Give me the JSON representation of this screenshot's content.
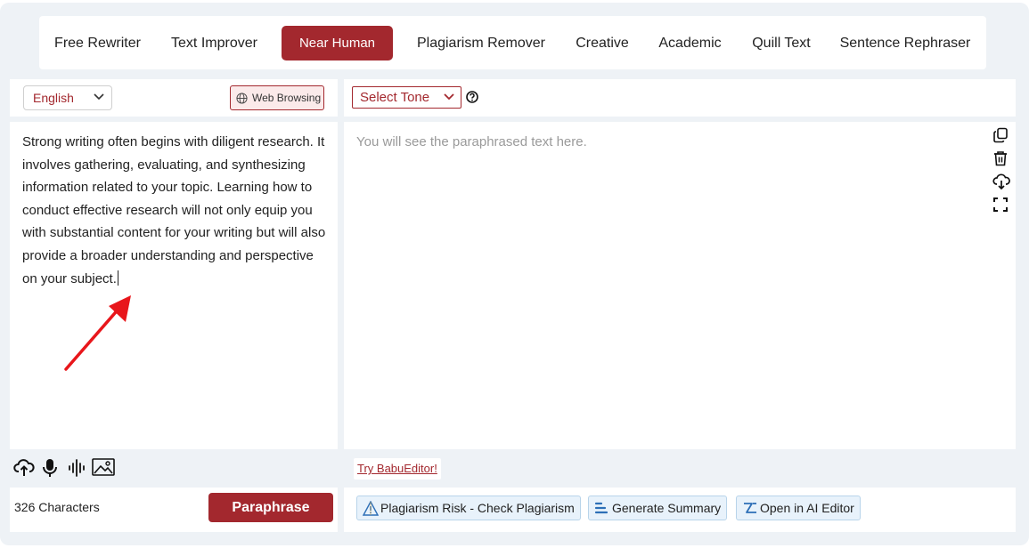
{
  "modes": [
    {
      "label": "Free Rewriter"
    },
    {
      "label": "Text Improver"
    },
    {
      "label": "Near Human",
      "active": true
    },
    {
      "label": "Plagiarism Remover"
    },
    {
      "label": "Creative"
    },
    {
      "label": "Academic"
    },
    {
      "label": "Quill Text"
    },
    {
      "label": "Sentence Rephraser"
    }
  ],
  "input_panel": {
    "language": "English",
    "web_browsing_label": "Web Browsing",
    "text": "Strong writing often begins with diligent research. It involves gathering, evaluating, and synthesizing information related to your topic. Learning how to conduct effective research will not only equip you with substantial content for your writing but will also provide a broader understanding and perspective on your subject.",
    "char_count": "326 Characters",
    "paraphrase_label": "Paraphrase"
  },
  "output_panel": {
    "tone_label": "Select Tone",
    "placeholder": "You will see the paraphrased text here.",
    "try_link": "Try BabuEditor!",
    "actions": {
      "plagiarism": "Plagiarism Risk - Check Plagiarism",
      "summary": "Generate Summary",
      "editor": "Open in AI Editor"
    }
  },
  "colors": {
    "accent": "#a3282e",
    "background": "#eef2f6",
    "action_bg": "#e8f2fb",
    "arrow": "#e8161b"
  },
  "icons": [
    "globe-icon",
    "chevron-down-icon",
    "help-icon",
    "copy-icon",
    "trash-icon",
    "download-cloud-icon",
    "fullscreen-icon",
    "upload-cloud-icon",
    "microphone-icon",
    "audio-wave-icon",
    "image-icon",
    "warning-icon",
    "summary-icon",
    "editor-icon"
  ]
}
